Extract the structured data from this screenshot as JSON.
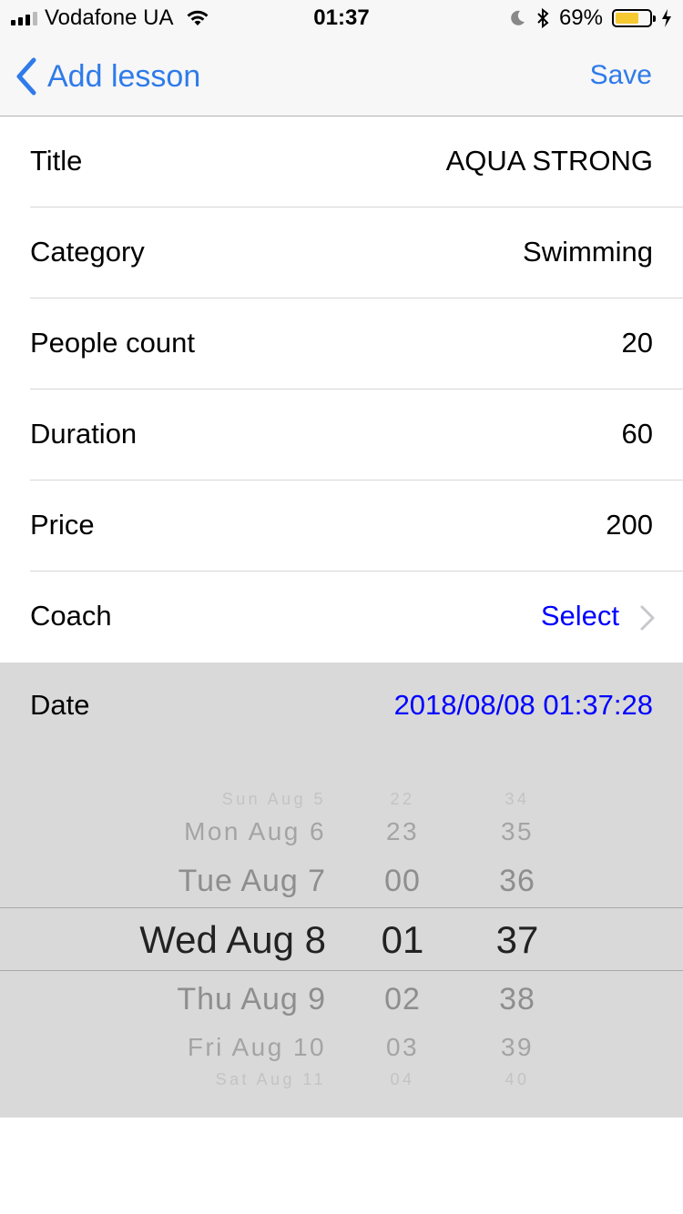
{
  "status_bar": {
    "carrier": "Vodafone UA",
    "time": "01:37",
    "battery": "69%",
    "battery_level": 0.69
  },
  "nav": {
    "back_label": "Add lesson",
    "save_label": "Save"
  },
  "form": {
    "rows": [
      {
        "label": "Title",
        "value": "AQUA STRONG"
      },
      {
        "label": "Category",
        "value": "Swimming"
      },
      {
        "label": "People count",
        "value": "20"
      },
      {
        "label": "Duration",
        "value": "60"
      },
      {
        "label": "Price",
        "value": "200"
      }
    ],
    "coach": {
      "label": "Coach",
      "value": "Select"
    },
    "date": {
      "label": "Date",
      "value": "2018/08/08 01:37:28"
    }
  },
  "picker": {
    "days": [
      "Sun Aug 5",
      "Mon Aug 6",
      "Tue Aug 7",
      "Wed Aug 8",
      "Thu Aug 9",
      "Fri Aug 10",
      "Sat Aug 11"
    ],
    "hours": [
      "22",
      "23",
      "00",
      "01",
      "02",
      "03",
      "04"
    ],
    "minutes": [
      "34",
      "35",
      "36",
      "37",
      "38",
      "39",
      "40"
    ]
  },
  "colors": {
    "accent": "#2f7bea",
    "link": "#0000ff",
    "picker_bg": "#d9d9d9",
    "battery_fill": "#f5c932"
  }
}
